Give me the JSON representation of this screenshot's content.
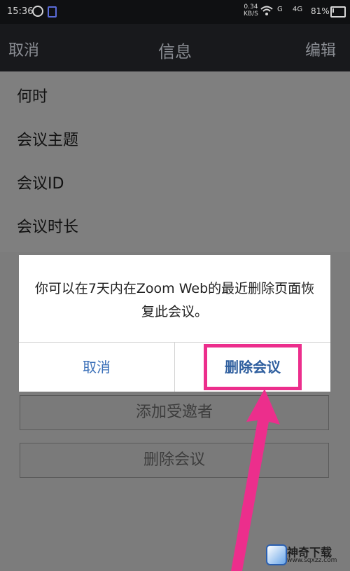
{
  "status_bar": {
    "time": "15:36",
    "speed_value": "0.34",
    "speed_unit": "KB/S",
    "signal1": "G",
    "signal2": "4G",
    "battery": "81%"
  },
  "nav": {
    "left": "取消",
    "title": "信息",
    "right": "编辑"
  },
  "list": {
    "rows": [
      "何时",
      "会议主题",
      "会议ID",
      "会议时长"
    ]
  },
  "background_buttons": {
    "add_invitee": "添加受邀者",
    "delete_meeting": "删除会议"
  },
  "dialog": {
    "message": "你可以在7天内在Zoom Web的最近删除页面恢复此会议。",
    "cancel": "取消",
    "delete": "删除会议"
  },
  "highlight_color": "#ec2e8c",
  "watermark": {
    "name": "神奇下载",
    "url": "www.sqxzz.com"
  }
}
